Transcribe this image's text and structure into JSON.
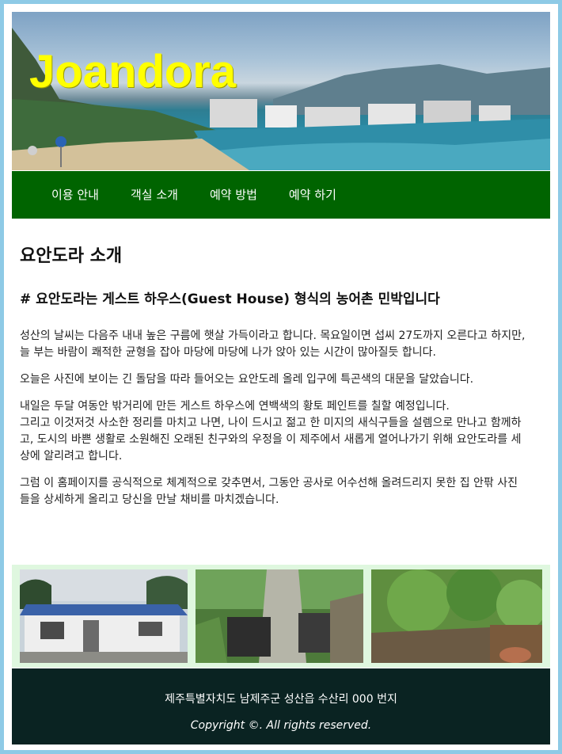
{
  "header": {
    "logo_text": "Joandora"
  },
  "nav": {
    "items": [
      {
        "label": "이용 안내"
      },
      {
        "label": "객실 소개"
      },
      {
        "label": "예약 방법"
      },
      {
        "label": "예약 하기"
      }
    ]
  },
  "main": {
    "title": "요안도라 소개",
    "subtitle": "# 요안도라는 게스트 하우스(Guest House) 형식의 농어촌 민박입니다",
    "paragraphs": [
      "성산의 날씨는 다음주 내내 높은 구름에 햇살 가득이라고 합니다. 목요일이면 섭씨 27도까지 오른다고 하지만, 늘 부는 바람이 쾌적한 균형을 잡아 마당에 마당에 나가 앉아 있는 시간이 많아질듯 합니다.",
      "오늘은 사진에 보이는 긴 돌담을 따라 들어오는 요안도레 올레 입구에 특곤색의 대문을 달았습니다.",
      "내일은 두달 여동안 밖거리에 만든 게스트 하우스에 연백색의 황토 페인트를 칠할 예정입니다.",
      "그리고 이것저것 사소한 정리를 마치고 나면, 나이 드시고 젊고 한 미지의 새식구들을 설렘으로 만나고 함께하고, 도시의 바쁜 생활로 소원해진 오래된 친구와의 우정을 이 제주에서 새롭게 열어나가기 위해 요안도라를 세상에 알리려고 합니다.",
      "그럼 이 홈페이지를 공식적으로 체계적으로 갖추면서, 그동안 공사로 어수선해 올려드리지 못한 집 안팎 사진들을 상세하게 올리고 당신을 만날 채비를 마치겠습니다."
    ]
  },
  "footer": {
    "address": "제주특별자치도 남제주군 성산읍 수산리 000 번지",
    "copyright": "Copyright ©. All rights reserved."
  },
  "colors": {
    "nav_bg": "#006400",
    "logo": "#ffff00",
    "footer_bg": "#0a2322",
    "photo_strip_bg": "#dff7df",
    "page_border": "#8ecae6"
  }
}
